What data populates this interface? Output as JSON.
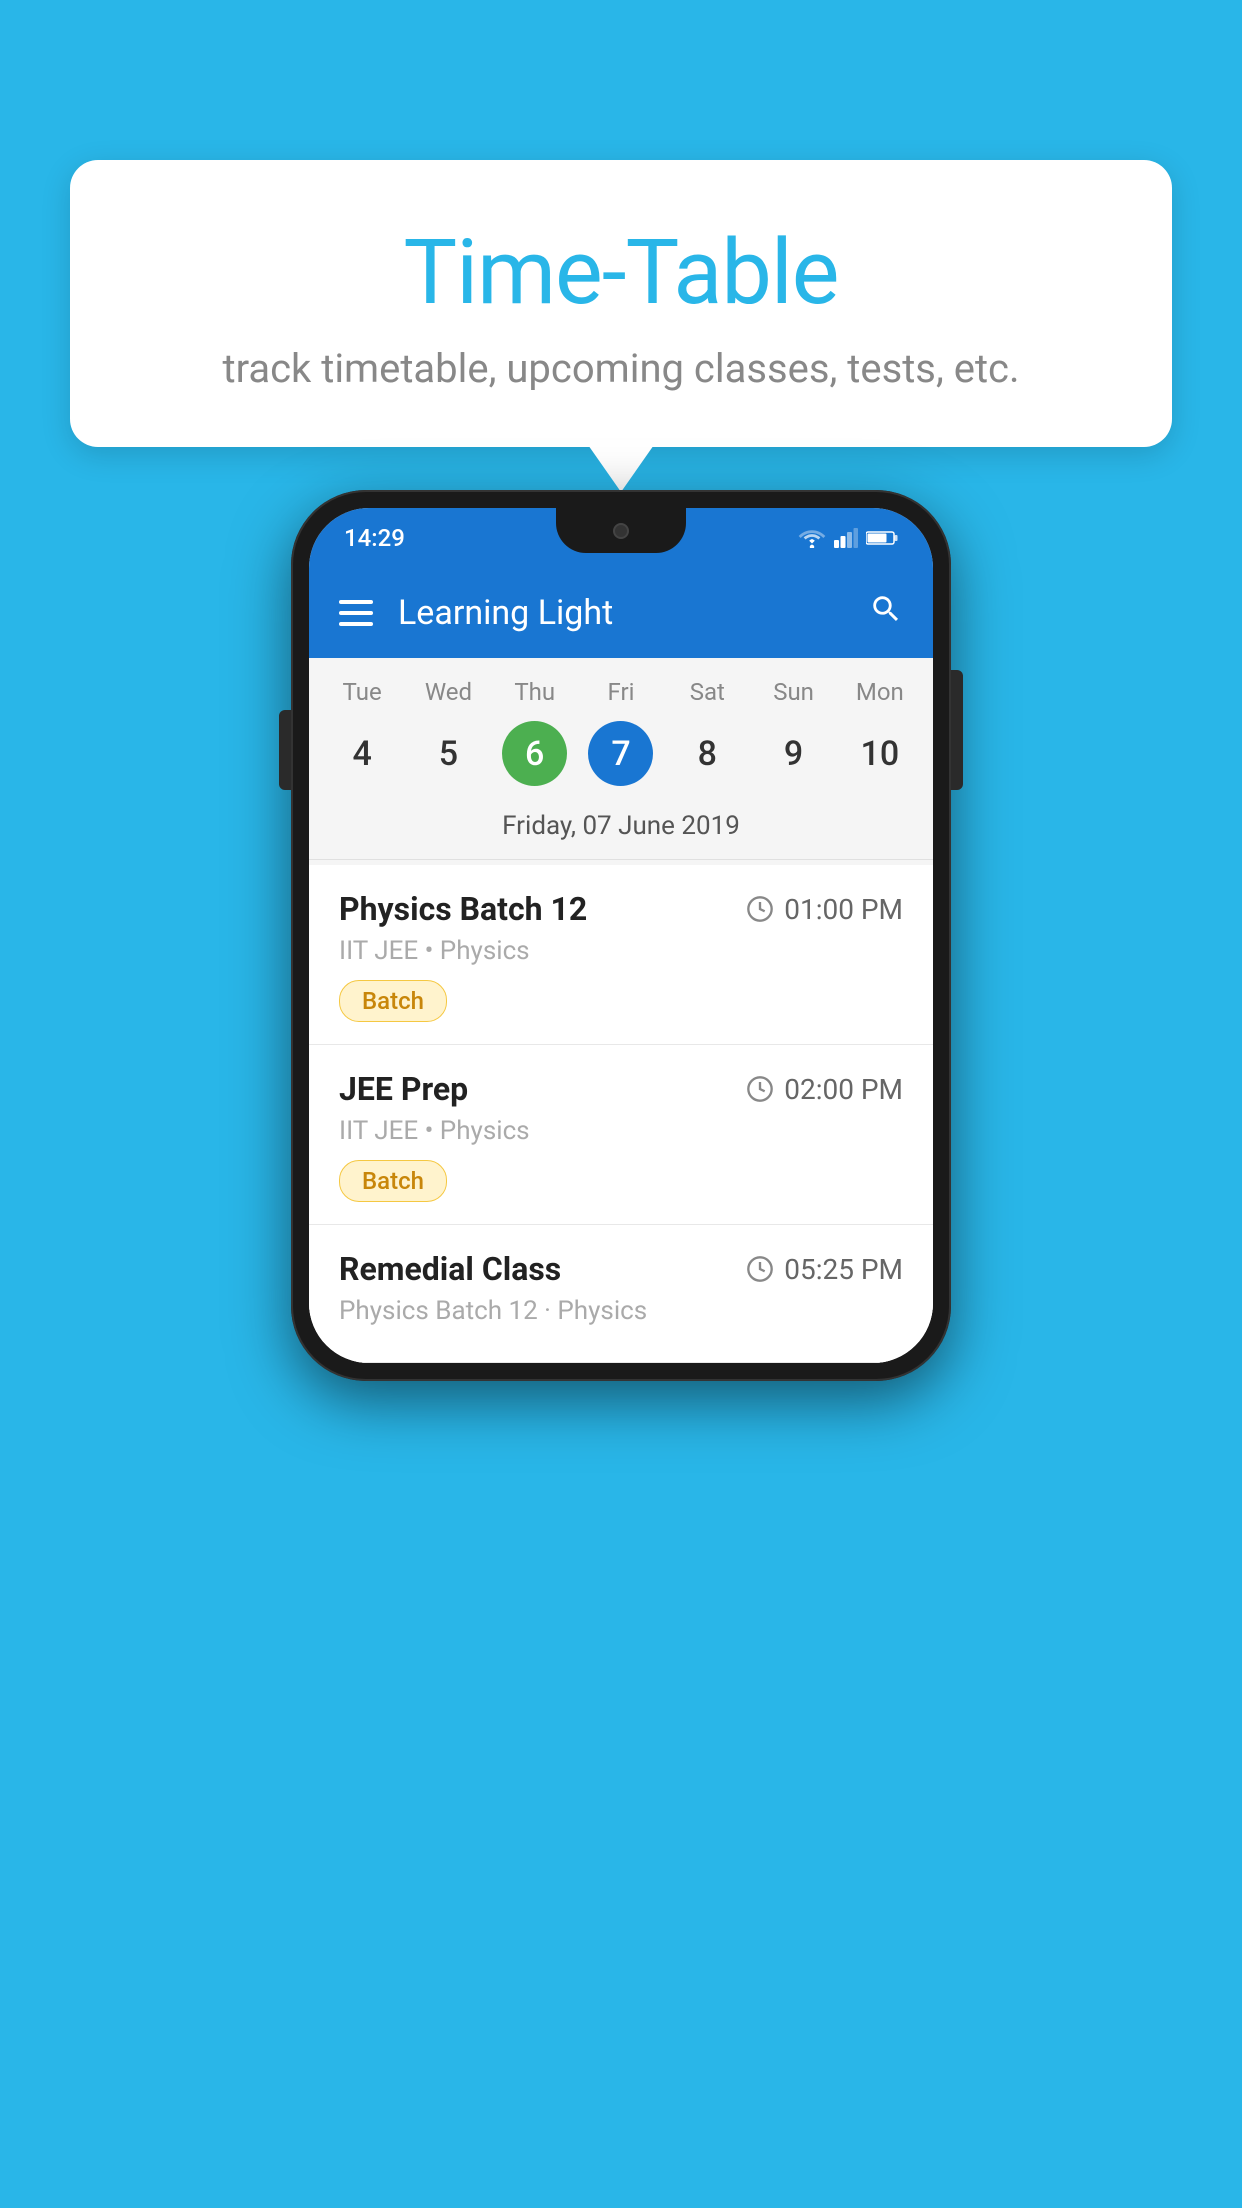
{
  "background": {
    "color": "#29B6E8"
  },
  "speech_bubble": {
    "title": "Time-Table",
    "subtitle": "track timetable, upcoming classes, tests, etc."
  },
  "phone": {
    "status_bar": {
      "time": "14:29"
    },
    "app_bar": {
      "title": "Learning Light"
    },
    "calendar": {
      "days": [
        "Tue",
        "Wed",
        "Thu",
        "Fri",
        "Sat",
        "Sun",
        "Mon"
      ],
      "dates": [
        "4",
        "5",
        "6",
        "7",
        "8",
        "9",
        "10"
      ],
      "today_index": 2,
      "selected_index": 3,
      "selected_date_label": "Friday, 07 June 2019"
    },
    "schedule": [
      {
        "title": "Physics Batch 12",
        "time": "01:00 PM",
        "subtitle": "IIT JEE • Physics",
        "badge": "Batch"
      },
      {
        "title": "JEE Prep",
        "time": "02:00 PM",
        "subtitle": "IIT JEE • Physics",
        "badge": "Batch"
      },
      {
        "title": "Remedial Class",
        "time": "05:25 PM",
        "subtitle": "Physics Batch 12 · Physics",
        "badge": ""
      }
    ]
  }
}
